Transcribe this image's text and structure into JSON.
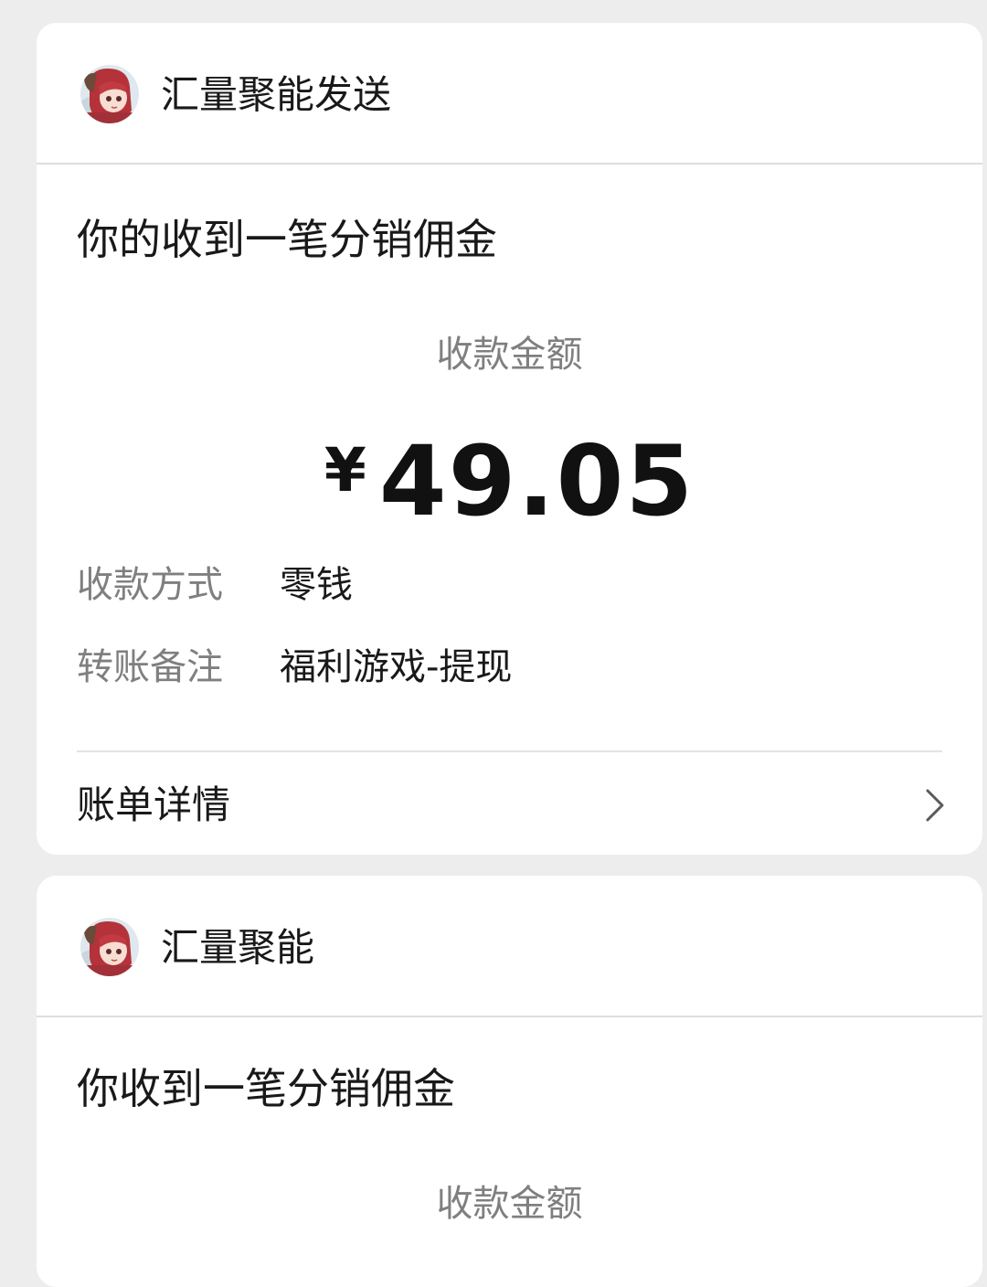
{
  "cards": [
    {
      "sender": "汇量聚能发送",
      "title": "你的收到一笔分销佣金",
      "amount_label": "收款金额",
      "currency_symbol": "¥",
      "amount": "49.05",
      "details": [
        {
          "key": "收款方式",
          "value": "零钱"
        },
        {
          "key": "转账备注",
          "value": "福利游戏-提现"
        }
      ],
      "bill_link": "账单详情"
    },
    {
      "sender": "汇量聚能",
      "title": "你收到一笔分销佣金",
      "amount_label": "收款金额"
    }
  ],
  "colors": {
    "page_background": "#ededed",
    "card_background": "#ffffff",
    "primary_text": "#191919",
    "secondary_text": "#7f7f7f"
  },
  "icons": {
    "avatar": "anime-girl-avatar-icon",
    "chevron": "chevron-right-icon"
  }
}
